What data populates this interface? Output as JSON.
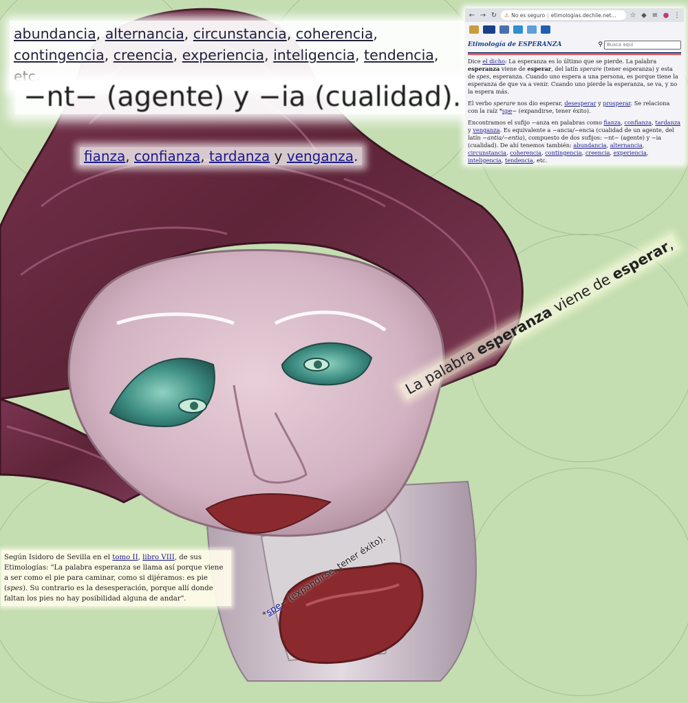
{
  "collage": {
    "suffix_words": [
      "abundancia",
      "alternancia",
      "circunstancia",
      "coherencia",
      "contingencia",
      "creencia",
      "experiencia",
      "inteligencia",
      "tendencia"
    ],
    "suffix_words_tail": ", etc.",
    "suffix_heading": "−nt− (agente) y −ia (cualidad).",
    "anza_words": [
      "fianza",
      "confianza",
      "tardanza",
      "venganza"
    ],
    "anza_joiners": [
      ", ",
      ", ",
      " y ",
      "."
    ],
    "rotated_sentence": {
      "prefix": "La palabra ",
      "bold1": "esperanza",
      "middle": " viene de ",
      "bold2": "esperar",
      "suffix": ","
    },
    "rotated_root": {
      "star": "*",
      "link": "spe",
      "rest": "− (expandirse, tener éxito)."
    }
  },
  "browser": {
    "url": "etimologias.dechile.net...",
    "security_label": "No es seguro",
    "search_placeholder": "Busca aquí",
    "site_title": "Etimología de ESPERANZA",
    "p1": {
      "a": "Dice ",
      "link": "el dicho",
      "b": ": La esperanza es lo último que se pierde. La palabra ",
      "bold1": "esperanza",
      "c": " viene de ",
      "bold2": "esperar",
      "d": ", del latín ",
      "ital1": "sperare",
      "e": " (tener esperanza) y esta de ",
      "ital2": "spes",
      "f": ", esperanza. Cuando uno espera a una persona, es porque tiene la esperanza de que va a venir. Cuando uno pierde la esperanza, se va, y no la espera más."
    },
    "p2": {
      "a": "El verbo ",
      "ital": "sperare",
      "b": " nos dio esperar, ",
      "link1": "desesperar",
      "c": " y ",
      "link2": "prosperar",
      "d": ". Se relaciona con la raíz *",
      "link3": "spe",
      "e": "− (expandirse, tener éxito)."
    },
    "p3": {
      "a": "Encontramos el sufijo −anza en palabras como ",
      "links1": [
        "fianza",
        "confianza",
        "tardanza"
      ],
      "y": " y ",
      "link_v": "venganza",
      "b": ". Es equivalente a −ancia/−encia (cualidad de un agente, del latín −",
      "ital": "antia/−entia",
      "c": "), compuesto de dos sufijos: −nt− (agente) y −ia (cualidad). De ahí tenemos también: ",
      "links2": [
        "abundancia",
        "alternancia",
        "circunstancia",
        "coherencia",
        "contingencia",
        "creencia",
        "experiencia",
        "inteligencia",
        "tendencia"
      ],
      "d": ", etc."
    }
  },
  "quote": {
    "a": "Según Isidoro de Sevilla en el ",
    "link1": "tomo II",
    "sep": ", ",
    "link2": "libro VIII",
    "b": ", de sus Etimologías: \"La palabra esperanza se llama así porque viene a ser como el pie para caminar, como si dijéramos: es pie (",
    "ital": "spes",
    "c": "). Su contrario es la desesperación, porque allí donde faltan los pies no hay posibilidad alguna de andar\"."
  },
  "colors": {
    "background": "#c4ddb1",
    "hair": "#6b2c44",
    "skin": "#d9b9c9",
    "eyes": "#3f8f84",
    "lips": "#8b2a2e",
    "link": "#1a1a8c"
  }
}
